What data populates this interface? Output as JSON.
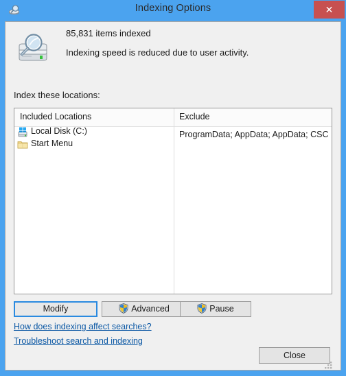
{
  "window": {
    "title": "Indexing Options",
    "title_icon": "indexing-disk-search-icon",
    "close_icon": "close-x-icon",
    "frame_color": "#4ba3ef",
    "close_button_color": "#c75050"
  },
  "status": {
    "icon": "disk-magnifier-icon",
    "items_indexed": "85,831 items indexed",
    "message": "Indexing speed is reduced due to user activity."
  },
  "locations": {
    "label": "Index these locations:",
    "columns": [
      "Included Locations",
      "Exclude"
    ],
    "rows": [
      {
        "icon": "windows-drive-icon",
        "label": "Local Disk (C:)"
      },
      {
        "icon": "folder-icon",
        "label": "Start Menu"
      }
    ],
    "exclude_value": "ProgramData; AppData; AppData; CSC"
  },
  "buttons": {
    "modify": "Modify",
    "advanced": "Advanced",
    "pause": "Pause",
    "close": "Close",
    "shield_icon": "uac-shield-icon",
    "focus_color": "#2a8ae0"
  },
  "links": {
    "help": "How does indexing affect searches?",
    "troubleshoot": "Troubleshoot search and indexing",
    "color": "#0a57a4"
  },
  "resize_grip": "resize-grip-icon"
}
